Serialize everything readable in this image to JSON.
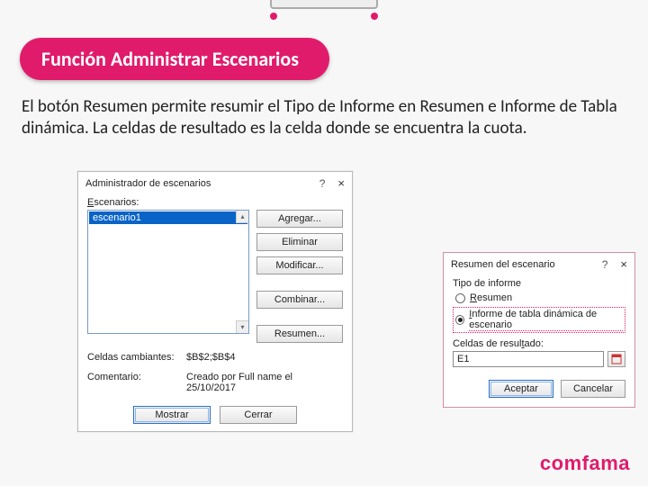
{
  "heading": "Función Administrar Escenarios",
  "body": "El botón Resumen permite resumir  el Tipo de Informe en Resumen e Informe de Tabla dinámica. La celdas  de resultado es la celda donde se encuentra la cuota.",
  "brand": "comfama",
  "dlg1": {
    "title": "Administrador de escenarios",
    "q": "?",
    "x": "×",
    "scenarios_label_pre": "E",
    "scenarios_label_rest": "scenarios:",
    "selected_item": "escenario1",
    "buttons": {
      "add": "Agregar...",
      "delete": "Eliminar",
      "modify": "Modificar...",
      "merge": "Combinar...",
      "summary": "Resumen..."
    },
    "cells_change_label": "Celdas cambiantes:",
    "cells_change_value": "$B$2;$B$4",
    "comment_label": "Comentario:",
    "comment_value": "Creado por Full name el 25/10/2017",
    "show": "Mostrar",
    "close": "Cerrar"
  },
  "dlg2": {
    "title": "Resumen del escenario",
    "q": "?",
    "x": "×",
    "type_label": "Tipo de informe",
    "opt1_pre": "R",
    "opt1_rest": "esumen",
    "opt2_pre": "I",
    "opt2_rest": "nforme de tabla dinámica de escenario",
    "cells_label_pre": "Celdas de resul",
    "cells_label_mid": "t",
    "cells_label_post": "ado:",
    "cells_value": "E1",
    "accept": "Aceptar",
    "cancel": "Cancelar"
  }
}
